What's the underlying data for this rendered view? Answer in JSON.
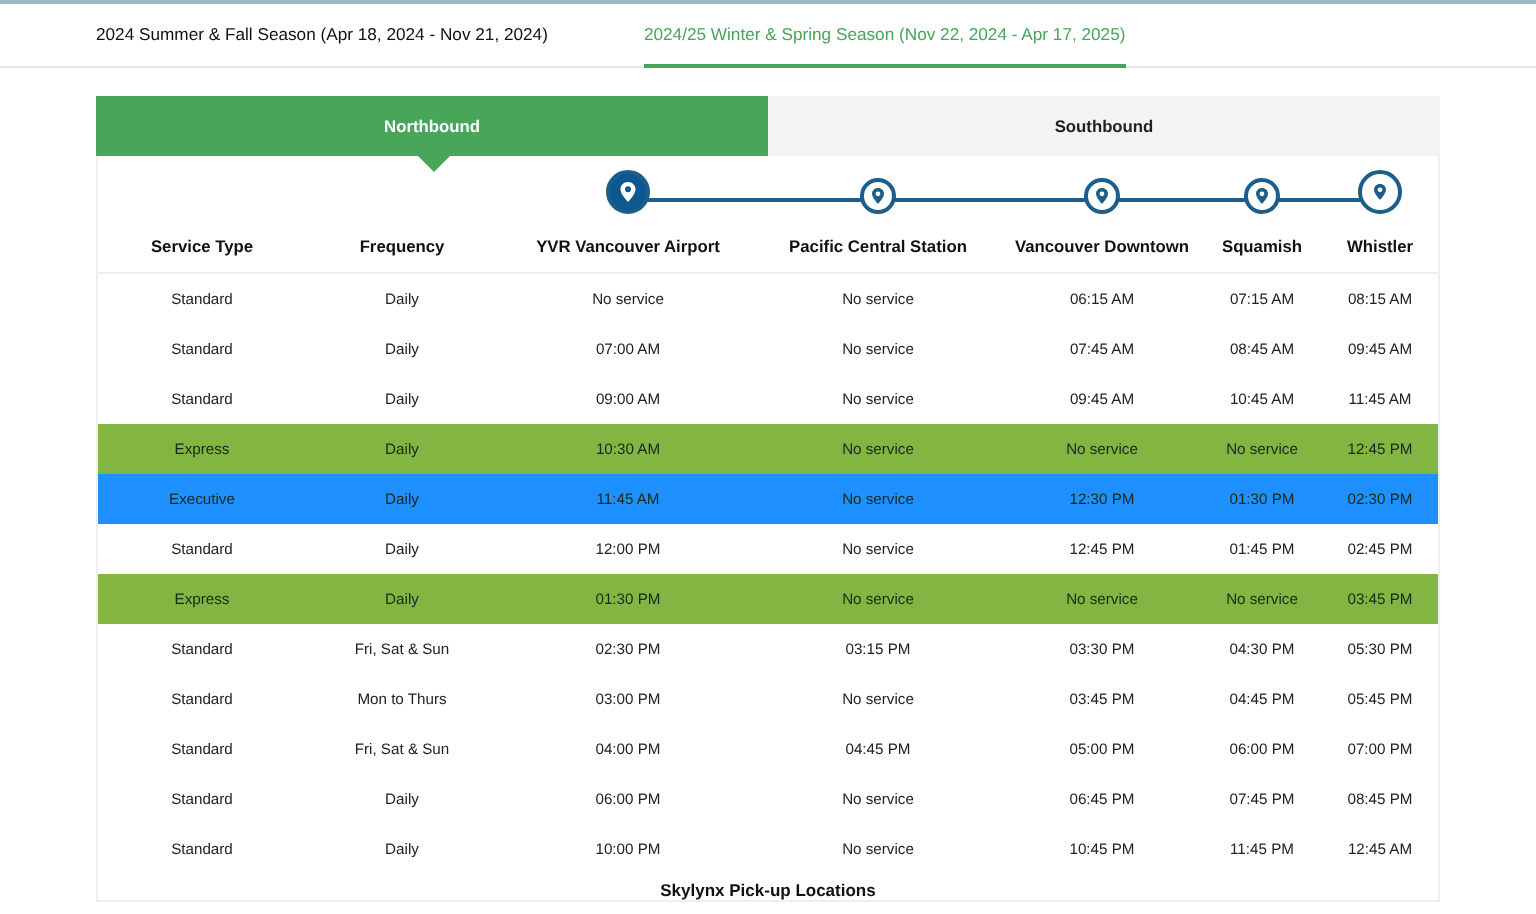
{
  "season_tabs": [
    {
      "label": "2024 Summer & Fall Season (Apr 18, 2024 - Nov 21, 2024)",
      "selected": false
    },
    {
      "label": "2024/25 Winter & Spring Season (Nov 22, 2024 - Apr 17, 2025)",
      "selected": true
    }
  ],
  "direction_tabs": [
    {
      "label": "Northbound",
      "selected": true
    },
    {
      "label": "Southbound",
      "selected": false
    }
  ],
  "columns": [
    {
      "kind": "text",
      "label": "Service Type"
    },
    {
      "kind": "text",
      "label": "Frequency"
    },
    {
      "kind": "stop",
      "label": "YVR Vancouver Airport",
      "selected": true
    },
    {
      "kind": "stop",
      "label": "Pacific Central Station",
      "selected": false
    },
    {
      "kind": "stop",
      "label": "Vancouver Downtown",
      "selected": false
    },
    {
      "kind": "stop",
      "label": "Squamish",
      "selected": false
    },
    {
      "kind": "stop",
      "label": "Whistler",
      "selected": false
    }
  ],
  "rows": [
    {
      "kind": "standard",
      "cells": [
        "Standard",
        "Daily",
        "No service",
        "No service",
        "06:15 AM",
        "07:15 AM",
        "08:15 AM"
      ]
    },
    {
      "kind": "standard",
      "cells": [
        "Standard",
        "Daily",
        "07:00 AM",
        "No service",
        "07:45 AM",
        "08:45 AM",
        "09:45 AM"
      ]
    },
    {
      "kind": "standard",
      "cells": [
        "Standard",
        "Daily",
        "09:00 AM",
        "No service",
        "09:45 AM",
        "10:45 AM",
        "11:45 AM"
      ]
    },
    {
      "kind": "express",
      "cells": [
        "Express",
        "Daily",
        "10:30 AM",
        "No service",
        "No service",
        "No service",
        "12:45 PM"
      ]
    },
    {
      "kind": "executive",
      "cells": [
        "Executive",
        "Daily",
        "11:45 AM",
        "No service",
        "12:30 PM",
        "01:30 PM",
        "02:30 PM"
      ]
    },
    {
      "kind": "standard",
      "cells": [
        "Standard",
        "Daily",
        "12:00 PM",
        "No service",
        "12:45 PM",
        "01:45 PM",
        "02:45 PM"
      ]
    },
    {
      "kind": "express",
      "cells": [
        "Express",
        "Daily",
        "01:30 PM",
        "No service",
        "No service",
        "No service",
        "03:45 PM"
      ]
    },
    {
      "kind": "standard",
      "cells": [
        "Standard",
        "Fri, Sat & Sun",
        "02:30 PM",
        "03:15 PM",
        "03:30 PM",
        "04:30 PM",
        "05:30 PM"
      ]
    },
    {
      "kind": "standard",
      "cells": [
        "Standard",
        "Mon to Thurs",
        "03:00 PM",
        "No service",
        "03:45 PM",
        "04:45 PM",
        "05:45 PM"
      ]
    },
    {
      "kind": "standard",
      "cells": [
        "Standard",
        "Fri, Sat & Sun",
        "04:00 PM",
        "04:45 PM",
        "05:00 PM",
        "06:00 PM",
        "07:00 PM"
      ]
    },
    {
      "kind": "standard",
      "cells": [
        "Standard",
        "Daily",
        "06:00 PM",
        "No service",
        "06:45 PM",
        "07:45 PM",
        "08:45 PM"
      ]
    },
    {
      "kind": "standard",
      "cells": [
        "Standard",
        "Daily",
        "10:00 PM",
        "No service",
        "10:45 PM",
        "11:45 PM",
        "12:45 AM"
      ]
    }
  ],
  "section_heading": "Skylynx Pick-up Locations"
}
